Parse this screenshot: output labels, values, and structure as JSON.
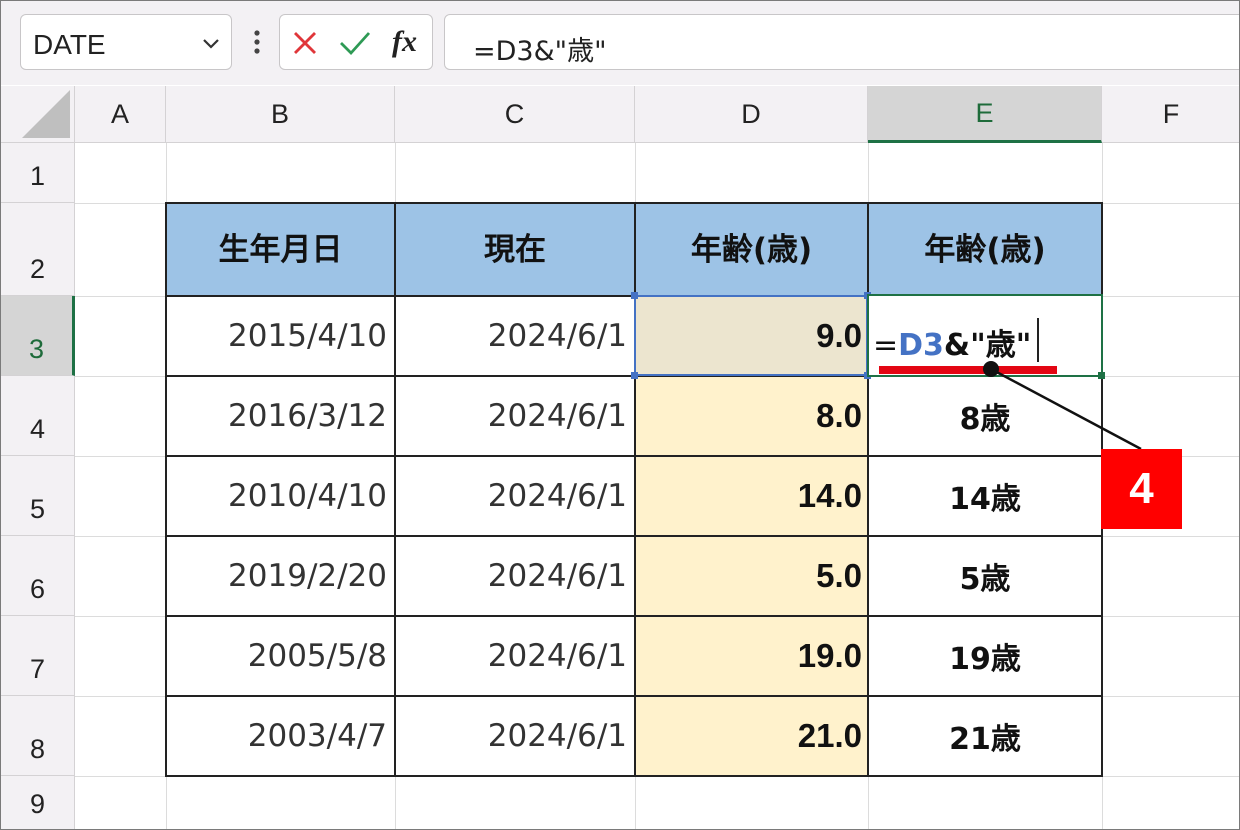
{
  "formula_bar": {
    "name_box": "DATE",
    "fx_label": "fx",
    "formula": "=D3&\"歳\""
  },
  "columns": [
    "A",
    "B",
    "C",
    "D",
    "E",
    "F"
  ],
  "active_column": "E",
  "rows": [
    "1",
    "2",
    "3",
    "4",
    "5",
    "6",
    "7",
    "8",
    "9"
  ],
  "active_row": "3",
  "table": {
    "headers": [
      "生年月日",
      "現在",
      "年齢(歳)",
      "年齢(歳)"
    ],
    "rows": [
      {
        "birth": "2015/4/10",
        "now": "2024/6/1",
        "age": "9.0",
        "age_text": ""
      },
      {
        "birth": "2016/3/12",
        "now": "2024/6/1",
        "age": "8.0",
        "age_text": "8歳"
      },
      {
        "birth": "2010/4/10",
        "now": "2024/6/1",
        "age": "14.0",
        "age_text": "14歳"
      },
      {
        "birth": "2019/2/20",
        "now": "2024/6/1",
        "age": "5.0",
        "age_text": "5歳"
      },
      {
        "birth": "2005/5/8",
        "now": "2024/6/1",
        "age": "19.0",
        "age_text": "19歳"
      },
      {
        "birth": "2003/4/7",
        "now": "2024/6/1",
        "age": "21.0",
        "age_text": "21歳"
      }
    ]
  },
  "edit_cell": {
    "eq": "=",
    "ref": "D3",
    "rest": "&\"歳\""
  },
  "callout": {
    "label": "4"
  },
  "colors": {
    "header_fill": "#9dc3e6",
    "age_fill": "#fff2cc",
    "accent_green": "#1e7145",
    "ref_blue": "#4472c4",
    "callout_red": "#ff0000"
  }
}
